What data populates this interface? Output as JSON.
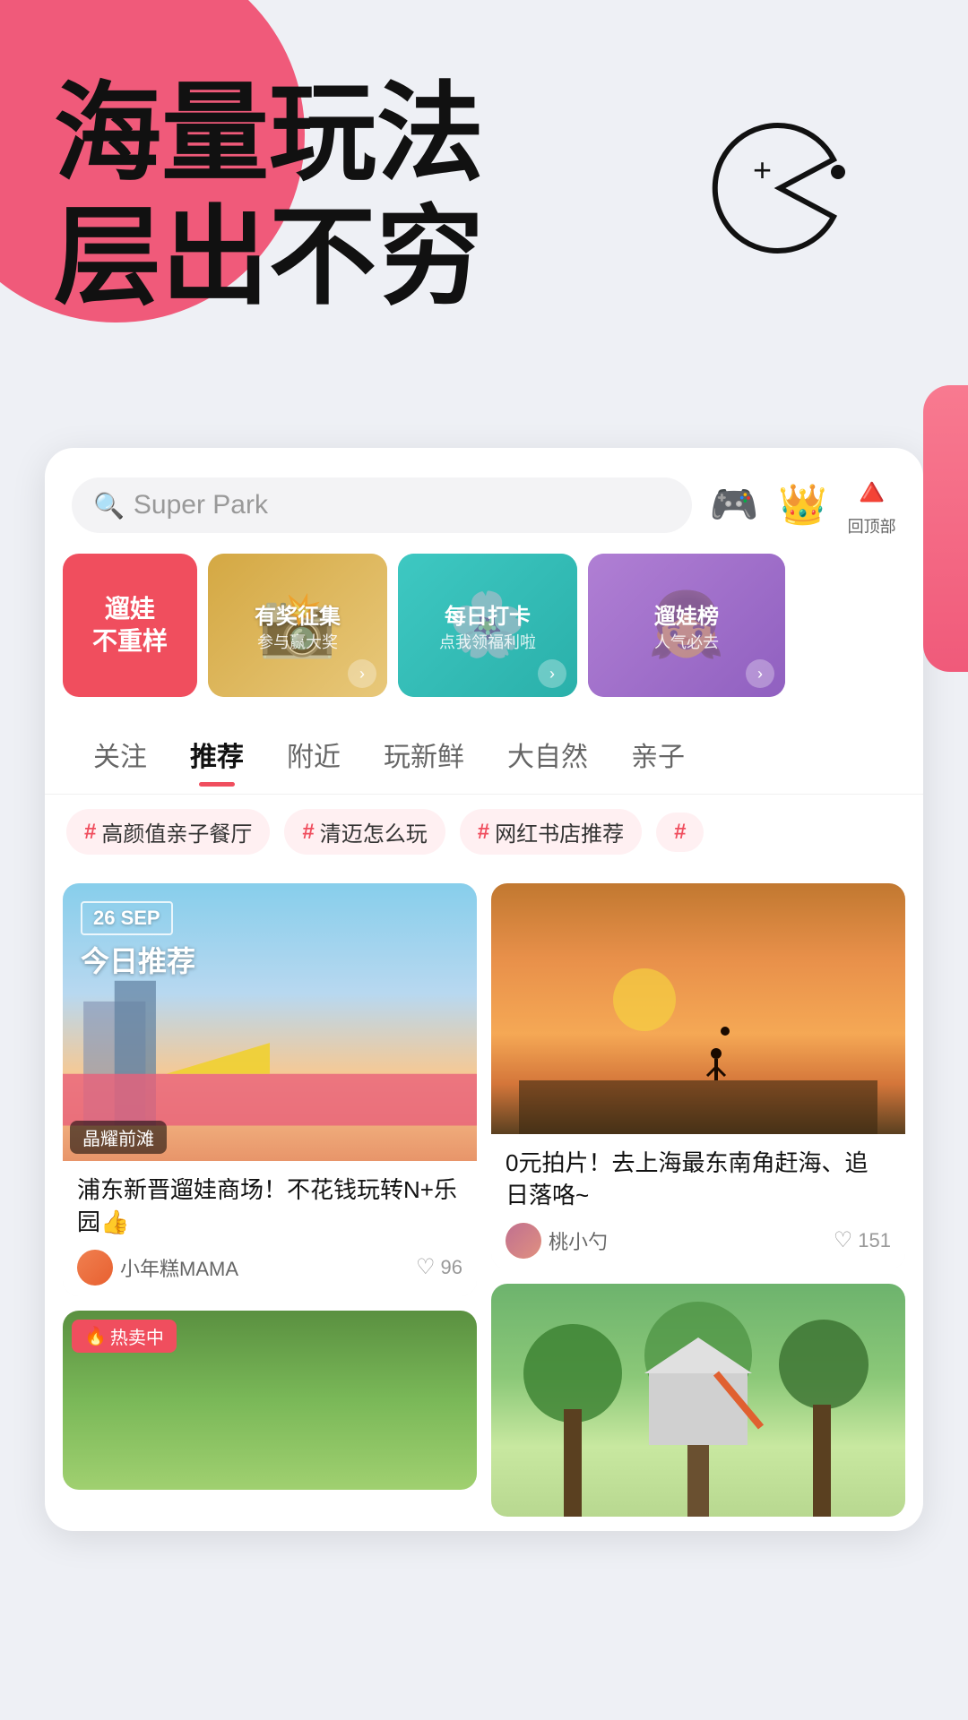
{
  "hero": {
    "line1": "海量玩法",
    "line2": "层出不穷"
  },
  "search": {
    "placeholder": "Super Park"
  },
  "header_icons": [
    {
      "emoji": "🎮",
      "label": ""
    },
    {
      "emoji": "👑",
      "label": ""
    },
    {
      "emoji": "🔺",
      "label": "回顶部"
    }
  ],
  "banners": [
    {
      "id": "b1",
      "type": "red",
      "line1": "遛娃",
      "line2": "不重样"
    },
    {
      "id": "b2",
      "type": "photo",
      "line1": "有奖征集",
      "line2": "参与赢大奖"
    },
    {
      "id": "b3",
      "type": "teal",
      "line1": "每日打卡",
      "line2": "点我领福利啦"
    },
    {
      "id": "b4",
      "type": "purple",
      "line1": "遛娃榜",
      "line2": "人气必去"
    }
  ],
  "nav_tabs": [
    {
      "id": "t1",
      "label": "关注",
      "active": false
    },
    {
      "id": "t2",
      "label": "推荐",
      "active": true
    },
    {
      "id": "t3",
      "label": "附近",
      "active": false
    },
    {
      "id": "t4",
      "label": "玩新鲜",
      "active": false
    },
    {
      "id": "t5",
      "label": "大自然",
      "active": false
    },
    {
      "id": "t6",
      "label": "亲子",
      "active": false
    }
  ],
  "tags": [
    {
      "id": "tag1",
      "label": "高颜值亲子餐厅"
    },
    {
      "id": "tag2",
      "label": "清迈怎么玩"
    },
    {
      "id": "tag3",
      "label": "网红书店推荐"
    }
  ],
  "cards": [
    {
      "id": "card1",
      "col": "left",
      "date": "26 SEP",
      "today_label": "今日推荐",
      "location": "晶耀前滩",
      "title": "浦东新晋遛娃商场！不花钱玩转N+乐园👍",
      "author": "小年糕MAMA",
      "likes": "96",
      "type": "sky"
    },
    {
      "id": "card2",
      "col": "right",
      "title": "0元拍片！去上海最东南角赶海、追日落咯~",
      "author": "桃小勺",
      "likes": "151",
      "type": "sunset"
    },
    {
      "id": "card3",
      "col": "right",
      "title": "",
      "type": "green",
      "partial": true
    },
    {
      "id": "card4",
      "col": "left",
      "hot_label": "热卖中",
      "type": "park",
      "partial": true
    }
  ]
}
